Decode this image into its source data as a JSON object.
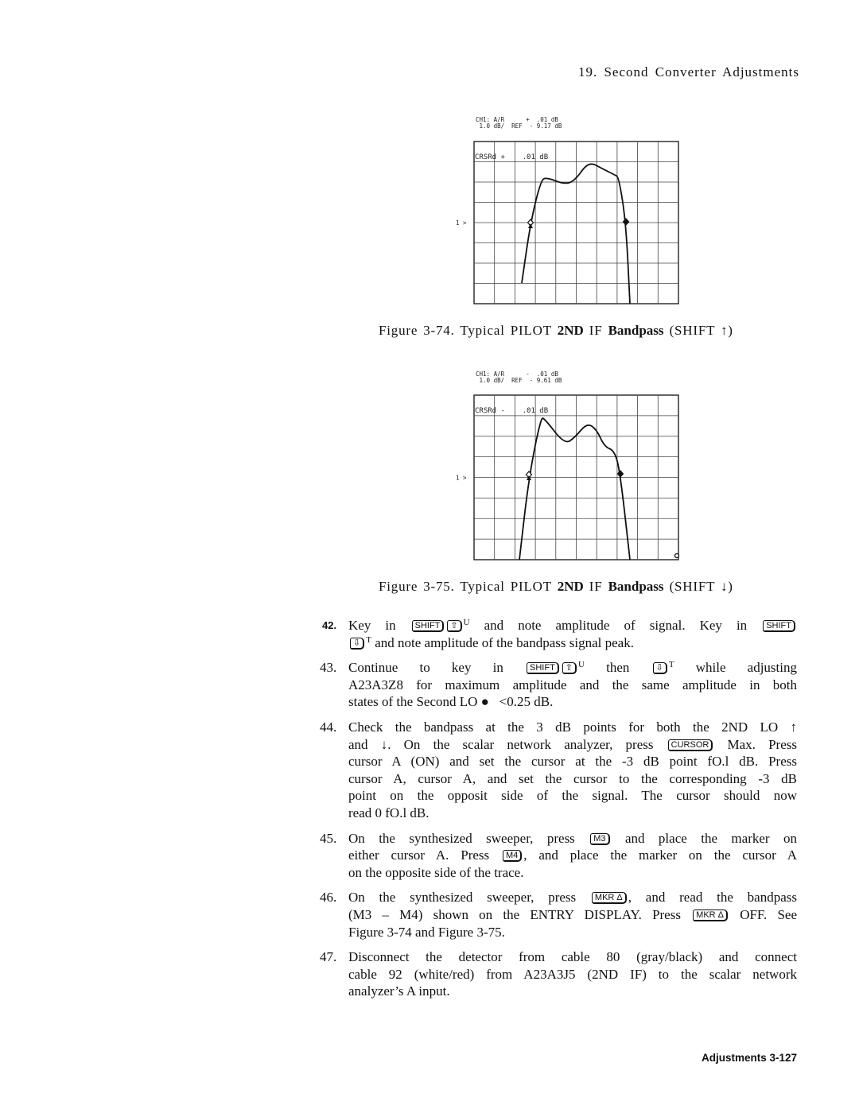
{
  "header": {
    "title": "19. Second Converter Adjustments"
  },
  "figures": [
    {
      "screen": {
        "line1": "CH1: A/R      +  .01 dB",
        "line2": " 1.0 dB/  REF  - 9.17 dB",
        "cursor_readout": "CRSRd +    .01 dB",
        "ref_marker": "1 >"
      },
      "caption": {
        "prefix": "Figure 3-74. Typical PILOT ",
        "bold1": "2ND",
        "mid": " IF ",
        "bold2": "Bandpass",
        "suffix": " (SHIFT ↑)"
      }
    },
    {
      "screen": {
        "line1": "CH1: A/R      -  .01 dB",
        "line2": " 1.0 dB/  REF  - 9.61 dB",
        "cursor_readout": "CRSRd -    .01 dB",
        "ref_marker": "1 >"
      },
      "caption": {
        "prefix": "Figure 3-75. Typical PILOT ",
        "bold1": "2ND",
        "mid": " IF ",
        "bold2": "Bandpass",
        "suffix": " (SHIFT ↓)"
      }
    }
  ],
  "steps": [
    {
      "num": "42.",
      "bold": true,
      "lines": [
        [
          {
            "t": "Key in "
          },
          {
            "k": "SHIFT"
          },
          {
            "k": "⇧"
          },
          {
            "s": "U"
          },
          {
            "t": " and note amplitude of signal. Key in "
          },
          {
            "k": "SHIFT"
          }
        ],
        [
          {
            "k": "⇩"
          },
          {
            "s": "T"
          },
          {
            "t": " and note amplitude of the bandpass signal peak."
          }
        ]
      ]
    },
    {
      "num": "43.",
      "lines": [
        [
          {
            "t": "Continue to key in "
          },
          {
            "k": "SHIFT"
          },
          {
            "k": "⇧"
          },
          {
            "s": "U"
          },
          {
            "t": " then "
          },
          {
            "k": "⇩"
          },
          {
            "s": "T"
          },
          {
            "t": " while adjusting"
          }
        ],
        [
          {
            "t": "A23A3Z8 for maximum amplitude and the same amplitude in both"
          }
        ],
        [
          {
            "t": "states of the Second LO ●   <0.25 dB."
          }
        ]
      ]
    },
    {
      "num": "44.",
      "lines": [
        [
          {
            "t": "Check the bandpass at the 3 dB points for both the 2ND LO ↑"
          }
        ],
        [
          {
            "t": "and ↓. On the scalar network analyzer, press "
          },
          {
            "k": "CURSOR"
          },
          {
            "t": " Max. Press"
          }
        ],
        [
          {
            "t": "cursor A (ON) and set the cursor at the -3 dB point fO.l dB. Press"
          }
        ],
        [
          {
            "t": "cursor A, cursor A, and set the cursor to the corresponding -3 dB"
          }
        ],
        [
          {
            "t": "point on the opposit side of the signal. The cursor should now"
          }
        ],
        [
          {
            "t": "read 0 fO.l dB."
          }
        ]
      ]
    },
    {
      "num": "45.",
      "lines": [
        [
          {
            "t": "On the synthesized sweeper, press "
          },
          {
            "k": "M3"
          },
          {
            "t": " and place the marker on"
          }
        ],
        [
          {
            "t": "either cursor A. Press "
          },
          {
            "k": "M4"
          },
          {
            "t": ", and place the marker on the cursor A"
          }
        ],
        [
          {
            "t": "on the opposite side of the trace."
          }
        ]
      ]
    },
    {
      "num": "46.",
      "lines": [
        [
          {
            "t": "On the synthesized sweeper, press "
          },
          {
            "k": "MKR Δ"
          },
          {
            "t": ", and read the bandpass"
          }
        ],
        [
          {
            "t": "(M3 – M4) shown on the ENTRY DISPLAY. Press "
          },
          {
            "k": "MKR Δ"
          },
          {
            "t": " OFF. See"
          }
        ],
        [
          {
            "t": "Figure 3-74 and Figure 3-75."
          }
        ]
      ]
    },
    {
      "num": "47.",
      "lines": [
        [
          {
            "t": "Disconnect the detector from cable 80 (gray/black) and connect"
          }
        ],
        [
          {
            "t": "cable 92 (white/red) from A23A3J5 (2ND IF) to the scalar network"
          }
        ],
        [
          {
            "t": "analyzer’s A input."
          }
        ]
      ]
    }
  ],
  "footer": {
    "label": "Adjustments 3-127"
  }
}
